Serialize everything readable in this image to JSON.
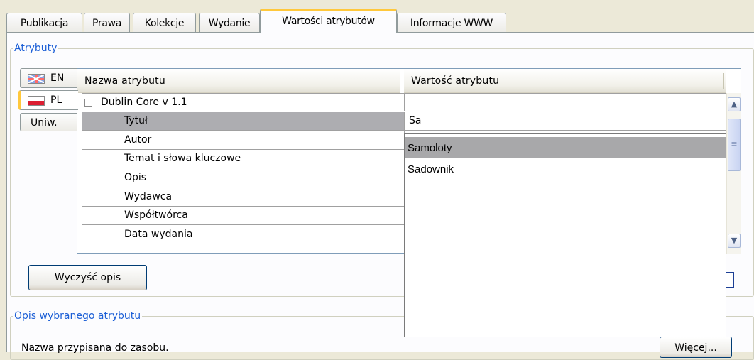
{
  "tabs": [
    {
      "label": "Publikacja"
    },
    {
      "label": "Prawa"
    },
    {
      "label": "Kolekcje"
    },
    {
      "label": "Wydanie"
    },
    {
      "label": "Wartości atrybutów",
      "active": true
    },
    {
      "label": "Informacje WWW"
    }
  ],
  "attributes_group": {
    "legend": "Atrybuty"
  },
  "languages": [
    {
      "label": "EN",
      "flag": "uk-flag-icon"
    },
    {
      "label": "PL",
      "flag": "pl-flag-icon",
      "active": true
    },
    {
      "label": "Uniw."
    }
  ],
  "grid": {
    "columns": [
      "Nazwa atrybutu",
      "Wartość atrybutu"
    ],
    "group_label": "Dublin Core v 1.1",
    "rows": [
      {
        "name": "Tytuł",
        "value": "Sa"
      },
      {
        "name": "Autor",
        "value": ""
      },
      {
        "name": "Temat i słowa kluczowe",
        "value": ""
      },
      {
        "name": "Opis",
        "value": ""
      },
      {
        "name": "Wydawca",
        "value": ""
      },
      {
        "name": "Współtwórca",
        "value": ""
      },
      {
        "name": "Data wydania",
        "value": ""
      }
    ]
  },
  "autocomplete": {
    "options": [
      "Samoloty",
      "Sadownik"
    ],
    "highlighted": "Samoloty"
  },
  "clear_button_label": "Wyczyść opis",
  "description_group": {
    "legend": "Opis wybranego atrybutu",
    "text": "Nazwa przypisana do zasobu.",
    "more_button_label": "Więcej..."
  },
  "colors": {
    "active_tab_accent": "#ffc83c",
    "legend_text": "#1c5fd6",
    "selected_row": "#adadb1"
  }
}
